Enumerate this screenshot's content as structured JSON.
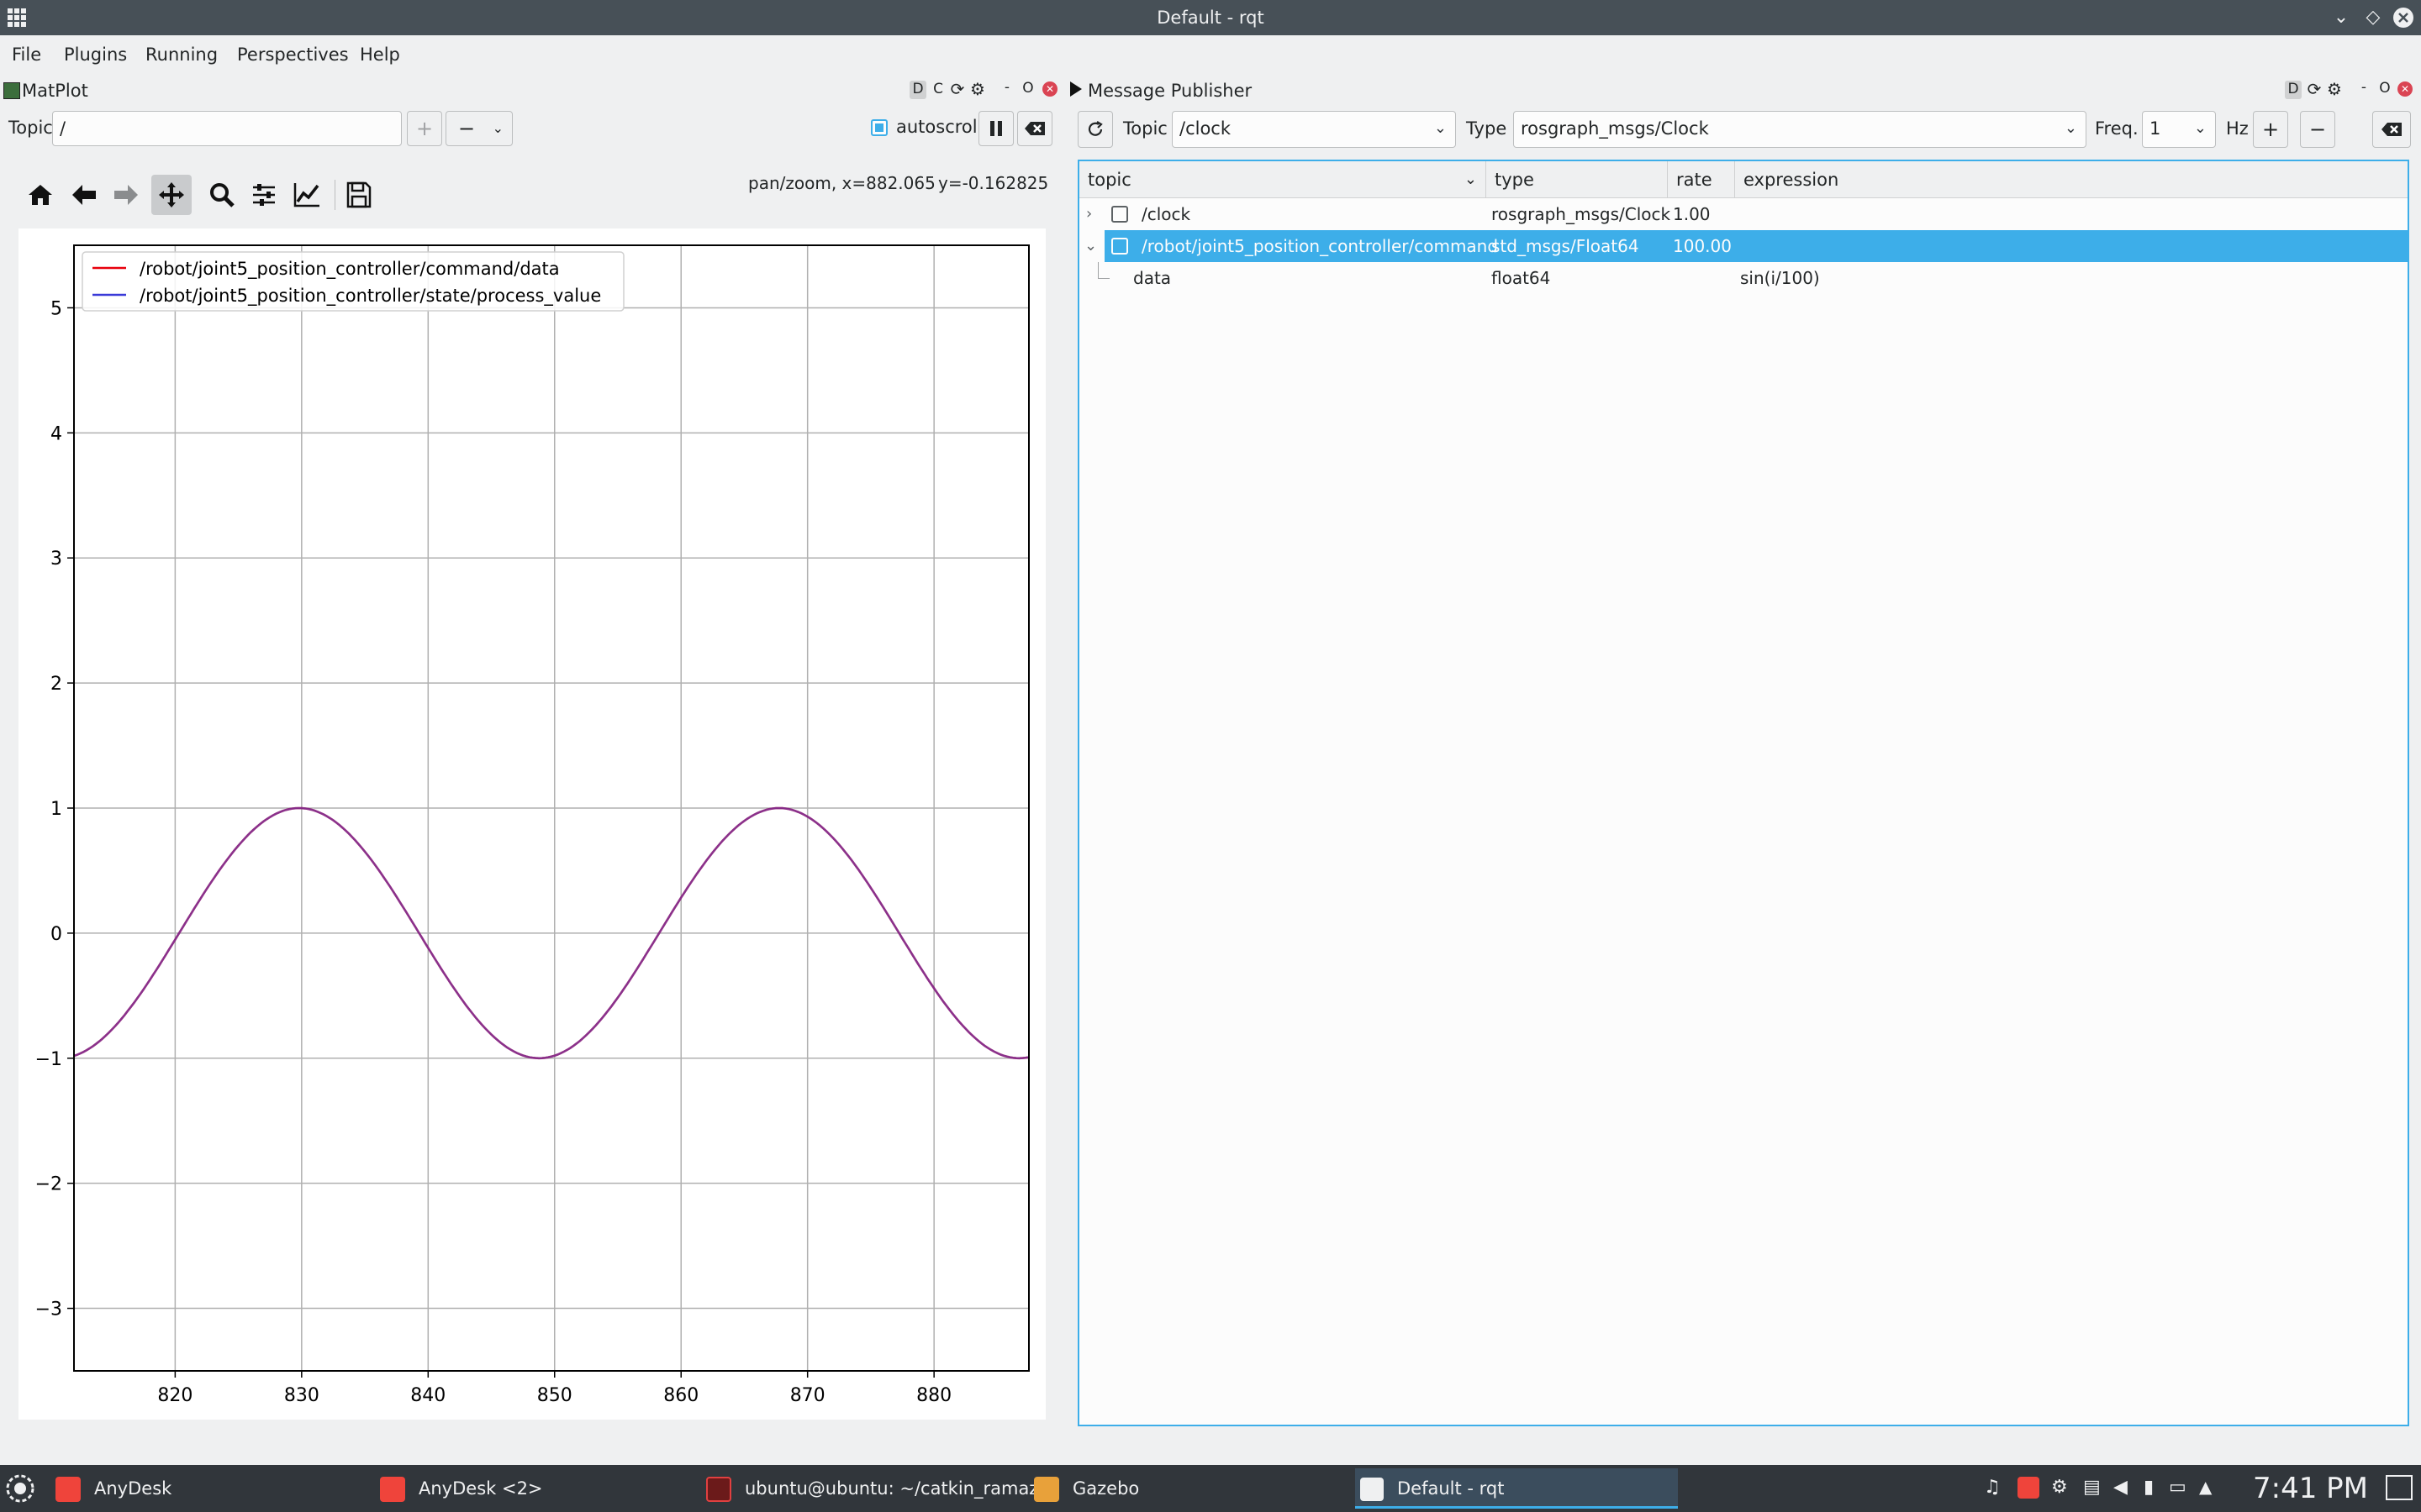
{
  "window": {
    "title": "Default - rqt"
  },
  "menu": [
    "File",
    "Plugins",
    "Running",
    "Perspectives",
    "Help"
  ],
  "matplot": {
    "title": "MatPlot",
    "header_buttons": [
      "D",
      "C",
      "⟳",
      "⚙",
      "-",
      "O",
      "✕"
    ],
    "topic_label": "Topic",
    "topic_value": "/",
    "add_label": "+",
    "remove_label": "−",
    "autoscroll_label": "autoscroll",
    "status_text": "pan/zoom, x=882.065",
    "status_y": "y=-0.162825"
  },
  "chart_data": {
    "type": "line",
    "title": "",
    "xlabel": "",
    "ylabel": "",
    "xlim": [
      812,
      887.5
    ],
    "ylim": [
      -3.5,
      5.5
    ],
    "xticks": [
      820,
      830,
      840,
      850,
      860,
      870,
      880
    ],
    "yticks": [
      5,
      4,
      3,
      2,
      1,
      0,
      -1,
      -2,
      -3
    ],
    "grid": true,
    "legend_position": "top-left",
    "series": [
      {
        "name": "/robot/joint5_position_controller/command/data",
        "color": "#e8000b",
        "function": "sin(x/6.04 + 8.70)"
      },
      {
        "name": "/robot/joint5_position_controller/state/process_value",
        "color": "#3a3ad8",
        "function": "sin(x/6.04 + 8.70)"
      }
    ],
    "x": [
      812,
      815,
      818,
      821,
      824,
      827,
      830,
      833,
      836,
      839,
      842,
      845,
      848,
      851,
      854,
      857,
      860,
      863,
      866,
      869,
      872,
      875,
      878,
      881,
      884,
      887
    ],
    "y_sample": "computed"
  },
  "publisher": {
    "title": "Message Publisher",
    "header_buttons": [
      "D",
      "⟳",
      "⚙",
      "-",
      "O",
      "✕"
    ],
    "topic_label": "Topic",
    "topic_value": "/clock",
    "type_label": "Type",
    "type_value": "rosgraph_msgs/Clock",
    "freq_label": "Freq.",
    "freq_value": "1",
    "hz_label": "Hz",
    "add_label": "+",
    "remove_label": "−",
    "columns": [
      "topic",
      "type",
      "rate",
      "expression"
    ],
    "rows": [
      {
        "topic": "/clock",
        "type": "rosgraph_msgs/Clock",
        "rate": "1.00",
        "expression": "",
        "expander": "›"
      },
      {
        "topic": "/robot/joint5_position_controller/command",
        "type": "std_msgs/Float64",
        "rate": "100.00",
        "expression": "",
        "expander": "⌄"
      },
      {
        "topic": "data",
        "type": "float64",
        "rate": "",
        "expression": "sin(i/100)"
      }
    ]
  },
  "taskbar": {
    "tasks": [
      "AnyDesk",
      "AnyDesk <2>",
      "ubuntu@ubuntu: ~/catkin_ramazan",
      "Gazebo",
      "Default - rqt"
    ],
    "clock": "7:41 PM"
  },
  "colors": {
    "accent": "#3daee9",
    "titlebar": "#475057",
    "taskbar": "#31363b"
  }
}
